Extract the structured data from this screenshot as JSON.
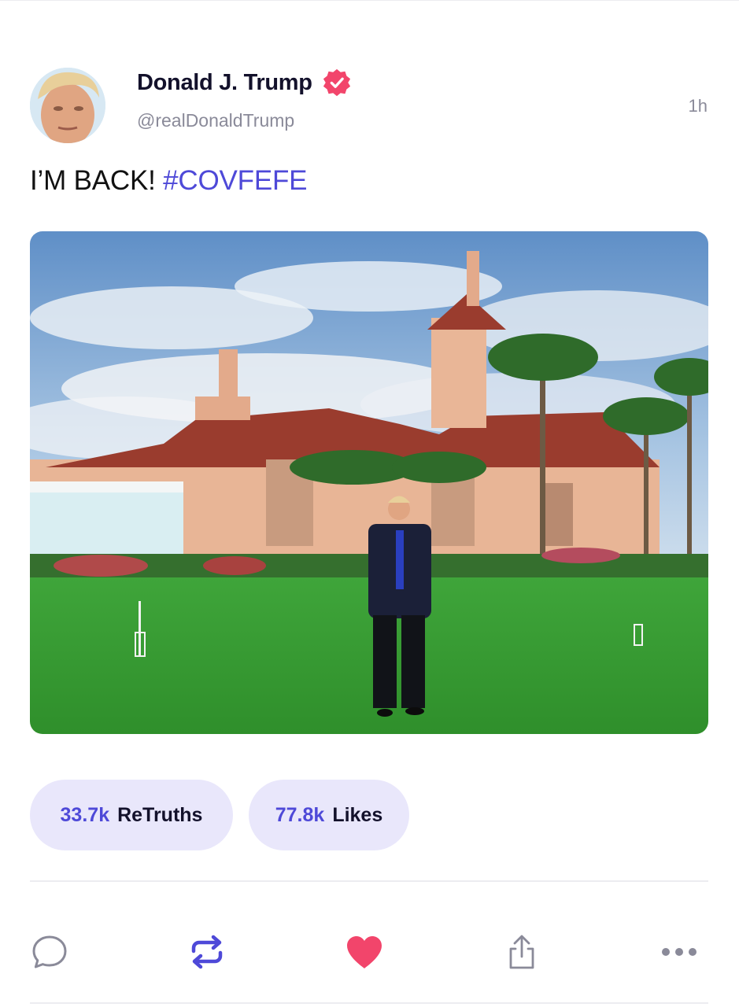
{
  "post": {
    "author_name": "Donald J. Trump",
    "handle": "@realDonaldTrump",
    "timestamp": "1h",
    "text": "I’M BACK! ",
    "hashtag": "#COVFEFE"
  },
  "stats": {
    "retruths_count": "33.7k",
    "retruths_label": "ReTruths",
    "likes_count": "77.8k",
    "likes_label": "Likes"
  },
  "actions": {
    "reply_icon": "speech-bubble-icon",
    "retruth_icon": "repost-arrows-icon",
    "like_icon": "heart-icon",
    "share_icon": "share-upload-icon",
    "more_icon": "ellipsis-icon"
  },
  "colors": {
    "accent": "#4e49d8",
    "pill_bg": "#e9e7fb",
    "like": "#f2456b",
    "verified": "#f2456b",
    "muted": "#8a8a99"
  }
}
